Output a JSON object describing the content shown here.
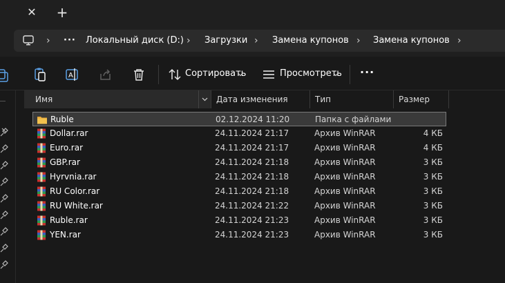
{
  "window": {
    "tab_close_glyph": "✕",
    "tab_new_glyph": "+"
  },
  "address": {
    "more_glyph": "···",
    "crumbs": [
      "Локальный диск (D:)",
      "Загрузки",
      "Замена купонов",
      "Замена купонов"
    ],
    "sep_glyph": "›"
  },
  "toolbar": {
    "sort_label": "Сортировать",
    "view_label": "Просмотреть",
    "more_glyph": "···"
  },
  "columns": {
    "name": "Имя",
    "date": "Дата изменения",
    "type": "Тип",
    "size": "Размер"
  },
  "files": [
    {
      "name": "Ruble",
      "date": "02.12.2024 11:20",
      "type": "Папка с файлами",
      "size": "",
      "kind": "folder",
      "selected": true
    },
    {
      "name": "Dollar.rar",
      "date": "24.11.2024 21:17",
      "type": "Архив WinRAR",
      "size": "4 КБ",
      "kind": "rar"
    },
    {
      "name": "Euro.rar",
      "date": "24.11.2024 21:17",
      "type": "Архив WinRAR",
      "size": "4 КБ",
      "kind": "rar"
    },
    {
      "name": "GBP.rar",
      "date": "24.11.2024 21:18",
      "type": "Архив WinRAR",
      "size": "3 КБ",
      "kind": "rar"
    },
    {
      "name": "Hyrvnia.rar",
      "date": "24.11.2024 21:18",
      "type": "Архив WinRAR",
      "size": "3 КБ",
      "kind": "rar"
    },
    {
      "name": "RU Color.rar",
      "date": "24.11.2024 21:18",
      "type": "Архив WinRAR",
      "size": "3 КБ",
      "kind": "rar"
    },
    {
      "name": "RU White.rar",
      "date": "24.11.2024 21:22",
      "type": "Архив WinRAR",
      "size": "3 КБ",
      "kind": "rar"
    },
    {
      "name": "Ruble.rar",
      "date": "24.11.2024 21:23",
      "type": "Архив WinRAR",
      "size": "3 КБ",
      "kind": "rar"
    },
    {
      "name": "YEN.rar",
      "date": "24.11.2024 21:23",
      "type": "Архив WinRAR",
      "size": "3 КБ",
      "kind": "rar"
    }
  ],
  "colors": {
    "background": "#191919",
    "selection": "#3a3a3a",
    "folder": "#f2c14e",
    "rar_red": "#c8322e",
    "rar_blue": "#3b5fc0"
  }
}
